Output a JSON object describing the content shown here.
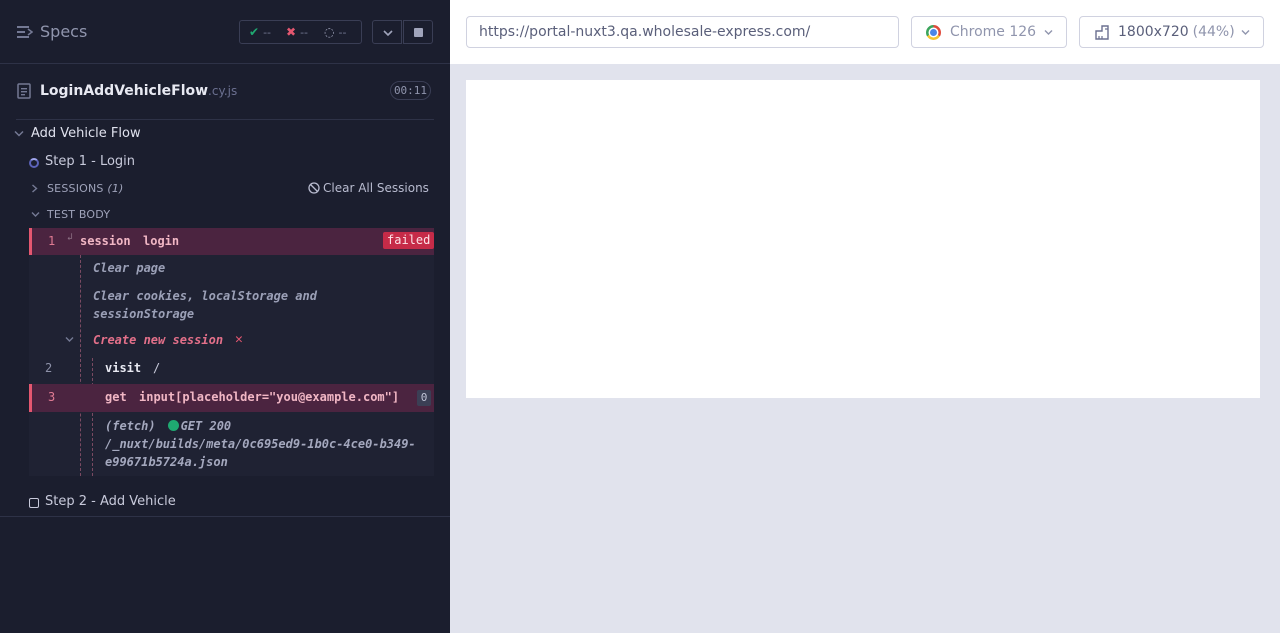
{
  "reporter": {
    "header": {
      "title": "Specs",
      "passed": "--",
      "failed": "--",
      "pending": "--"
    },
    "spec": {
      "name": "LoginAddVehicleFlow",
      "ext": ".cy.js",
      "duration": "00:11"
    },
    "suite": {
      "title": "Add Vehicle Flow"
    },
    "test1": {
      "title": "Step 1 - Login",
      "sessions_label": "SESSIONS",
      "sessions_count": "(1)",
      "clear_sessions": "Clear All Sessions",
      "body_label": "TEST BODY"
    },
    "commands": {
      "c1_num": "1",
      "c1_name": "session",
      "c1_msg": "login",
      "c1_status": "failed",
      "log_clear_page": "Clear page",
      "log_clear_storage_1": "Clear cookies, localStorage and",
      "log_clear_storage_2": "sessionStorage",
      "log_create_session": "Create new session",
      "c2_num": "2",
      "c2_name": "visit",
      "c2_msg": "/",
      "c3_num": "3",
      "c3_name": "get",
      "c3_msg": "input[placeholder=\"you@example.com\"]",
      "c3_count": "0",
      "fetch_label": "(fetch)",
      "fetch_status": "GET 200",
      "fetch_url_1": "/_nuxt/builds/meta/0c695ed9-1b0c-4ce0-b349-",
      "fetch_url_2": "e99671b5724a.json"
    },
    "test2": {
      "title": "Step 2 - Add Vehicle"
    }
  },
  "aut": {
    "url": "https://portal-nuxt3.qa.wholesale-express.com/",
    "browser": "Chrome 126",
    "viewport": "1800x720",
    "zoom": "(44%)"
  },
  "colors": {
    "passed": "#1fa971",
    "failed": "#e45770",
    "running": "#5c63ba"
  }
}
